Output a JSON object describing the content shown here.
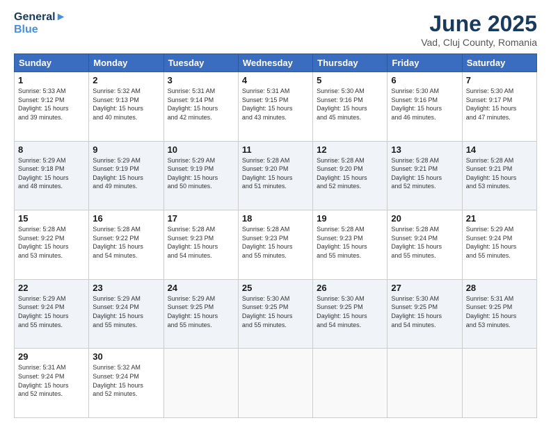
{
  "header": {
    "title": "June 2025",
    "subtitle": "Vad, Cluj County, Romania"
  },
  "columns": [
    "Sunday",
    "Monday",
    "Tuesday",
    "Wednesday",
    "Thursday",
    "Friday",
    "Saturday"
  ],
  "weeks": [
    [
      {
        "day": 1,
        "info": "Sunrise: 5:33 AM\nSunset: 9:12 PM\nDaylight: 15 hours\nand 39 minutes."
      },
      {
        "day": 2,
        "info": "Sunrise: 5:32 AM\nSunset: 9:13 PM\nDaylight: 15 hours\nand 40 minutes."
      },
      {
        "day": 3,
        "info": "Sunrise: 5:31 AM\nSunset: 9:14 PM\nDaylight: 15 hours\nand 42 minutes."
      },
      {
        "day": 4,
        "info": "Sunrise: 5:31 AM\nSunset: 9:15 PM\nDaylight: 15 hours\nand 43 minutes."
      },
      {
        "day": 5,
        "info": "Sunrise: 5:30 AM\nSunset: 9:16 PM\nDaylight: 15 hours\nand 45 minutes."
      },
      {
        "day": 6,
        "info": "Sunrise: 5:30 AM\nSunset: 9:16 PM\nDaylight: 15 hours\nand 46 minutes."
      },
      {
        "day": 7,
        "info": "Sunrise: 5:30 AM\nSunset: 9:17 PM\nDaylight: 15 hours\nand 47 minutes."
      }
    ],
    [
      {
        "day": 8,
        "info": "Sunrise: 5:29 AM\nSunset: 9:18 PM\nDaylight: 15 hours\nand 48 minutes."
      },
      {
        "day": 9,
        "info": "Sunrise: 5:29 AM\nSunset: 9:19 PM\nDaylight: 15 hours\nand 49 minutes."
      },
      {
        "day": 10,
        "info": "Sunrise: 5:29 AM\nSunset: 9:19 PM\nDaylight: 15 hours\nand 50 minutes."
      },
      {
        "day": 11,
        "info": "Sunrise: 5:28 AM\nSunset: 9:20 PM\nDaylight: 15 hours\nand 51 minutes."
      },
      {
        "day": 12,
        "info": "Sunrise: 5:28 AM\nSunset: 9:20 PM\nDaylight: 15 hours\nand 52 minutes."
      },
      {
        "day": 13,
        "info": "Sunrise: 5:28 AM\nSunset: 9:21 PM\nDaylight: 15 hours\nand 52 minutes."
      },
      {
        "day": 14,
        "info": "Sunrise: 5:28 AM\nSunset: 9:21 PM\nDaylight: 15 hours\nand 53 minutes."
      }
    ],
    [
      {
        "day": 15,
        "info": "Sunrise: 5:28 AM\nSunset: 9:22 PM\nDaylight: 15 hours\nand 53 minutes."
      },
      {
        "day": 16,
        "info": "Sunrise: 5:28 AM\nSunset: 9:22 PM\nDaylight: 15 hours\nand 54 minutes."
      },
      {
        "day": 17,
        "info": "Sunrise: 5:28 AM\nSunset: 9:23 PM\nDaylight: 15 hours\nand 54 minutes."
      },
      {
        "day": 18,
        "info": "Sunrise: 5:28 AM\nSunset: 9:23 PM\nDaylight: 15 hours\nand 55 minutes."
      },
      {
        "day": 19,
        "info": "Sunrise: 5:28 AM\nSunset: 9:23 PM\nDaylight: 15 hours\nand 55 minutes."
      },
      {
        "day": 20,
        "info": "Sunrise: 5:28 AM\nSunset: 9:24 PM\nDaylight: 15 hours\nand 55 minutes."
      },
      {
        "day": 21,
        "info": "Sunrise: 5:29 AM\nSunset: 9:24 PM\nDaylight: 15 hours\nand 55 minutes."
      }
    ],
    [
      {
        "day": 22,
        "info": "Sunrise: 5:29 AM\nSunset: 9:24 PM\nDaylight: 15 hours\nand 55 minutes."
      },
      {
        "day": 23,
        "info": "Sunrise: 5:29 AM\nSunset: 9:24 PM\nDaylight: 15 hours\nand 55 minutes."
      },
      {
        "day": 24,
        "info": "Sunrise: 5:29 AM\nSunset: 9:25 PM\nDaylight: 15 hours\nand 55 minutes."
      },
      {
        "day": 25,
        "info": "Sunrise: 5:30 AM\nSunset: 9:25 PM\nDaylight: 15 hours\nand 55 minutes."
      },
      {
        "day": 26,
        "info": "Sunrise: 5:30 AM\nSunset: 9:25 PM\nDaylight: 15 hours\nand 54 minutes."
      },
      {
        "day": 27,
        "info": "Sunrise: 5:30 AM\nSunset: 9:25 PM\nDaylight: 15 hours\nand 54 minutes."
      },
      {
        "day": 28,
        "info": "Sunrise: 5:31 AM\nSunset: 9:25 PM\nDaylight: 15 hours\nand 53 minutes."
      }
    ],
    [
      {
        "day": 29,
        "info": "Sunrise: 5:31 AM\nSunset: 9:24 PM\nDaylight: 15 hours\nand 52 minutes."
      },
      {
        "day": 30,
        "info": "Sunrise: 5:32 AM\nSunset: 9:24 PM\nDaylight: 15 hours\nand 52 minutes."
      },
      null,
      null,
      null,
      null,
      null
    ]
  ]
}
